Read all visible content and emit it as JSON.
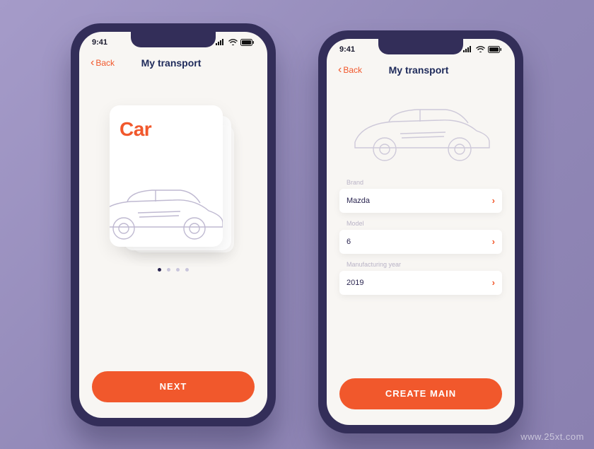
{
  "watermark": "www.25xt.com",
  "status": {
    "time": "9:41"
  },
  "nav": {
    "back": "Back",
    "title": "My transport"
  },
  "left": {
    "card_title": "Car",
    "cta": "NEXT",
    "dot_count": 4,
    "active_dot": 0
  },
  "right": {
    "fields": [
      {
        "label": "Brand",
        "value": "Mazda"
      },
      {
        "label": "Model",
        "value": "6"
      },
      {
        "label": "Manufacturing year",
        "value": "2019"
      }
    ],
    "cta": "CREATE MAIN"
  },
  "colors": {
    "accent": "#f1582c",
    "navy": "#1e2a5a"
  }
}
